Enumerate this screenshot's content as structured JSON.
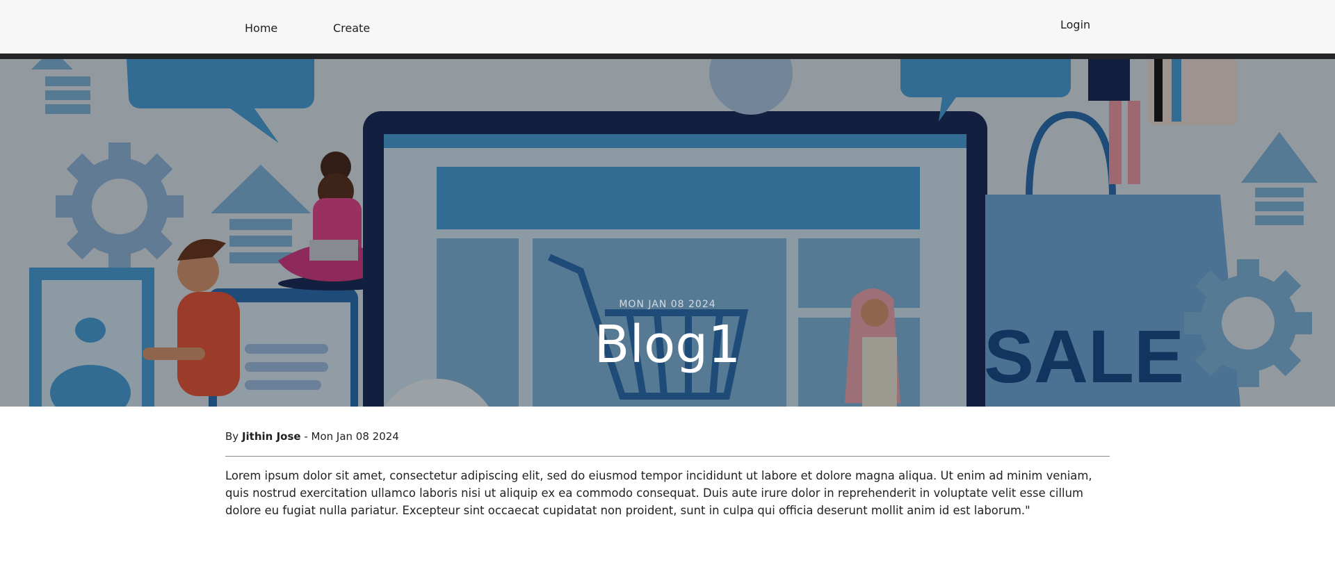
{
  "nav": {
    "home_label": "Home",
    "create_label": "Create",
    "login_label": "Login"
  },
  "hero": {
    "date": "MON JAN 08 2024",
    "title": "Blog1",
    "illustration_text": "SALE"
  },
  "post": {
    "by_label": "By",
    "author": "Jithin Jose",
    "separator": " - ",
    "date": "Mon Jan 08 2024",
    "body": "Lorem ipsum dolor sit amet, consectetur adipiscing elit, sed do eiusmod tempor incididunt ut labore et dolore magna aliqua. Ut enim ad minim veniam, quis nostrud exercitation ullamco laboris nisi ut aliquip ex ea commodo consequat. Duis aute irure dolor in reprehenderit in voluptate velit esse cillum dolore eu fugiat nulla pariatur. Excepteur sint occaecat cupidatat non proident, sunt in culpa qui officia deserunt mollit anim id est laborum.\""
  },
  "colors": {
    "navbar_bg": "#f7f7f7",
    "nav_bottom_bar": "#232528",
    "illustration_blue": "#4a9fd8",
    "illustration_navy": "#1b2f5e"
  }
}
